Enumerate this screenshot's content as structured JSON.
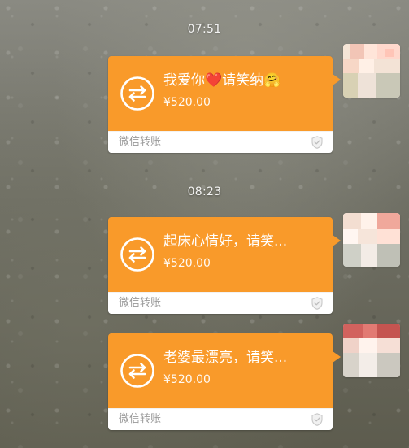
{
  "timestamps": [
    {
      "time": "07:51"
    },
    {
      "time": "08:23"
    }
  ],
  "messages": [
    {
      "title_prefix": "我爱你",
      "title_suffix": "请笑纳",
      "title_emojis": [
        "❤️",
        "🤗"
      ],
      "amount": "¥520.00",
      "footer": "微信转账"
    },
    {
      "title": "起床心情好，请笑...",
      "amount": "¥520.00",
      "footer": "微信转账"
    },
    {
      "title": "老婆最漂亮，请笑...",
      "amount": "¥520.00",
      "footer": "微信转账"
    }
  ],
  "colors": {
    "transfer_orange": "#f99a2a",
    "footer_gray": "#999999",
    "white": "#ffffff"
  },
  "icons": {
    "transfer": "transfer-arrows-icon",
    "shield": "shield-icon"
  }
}
